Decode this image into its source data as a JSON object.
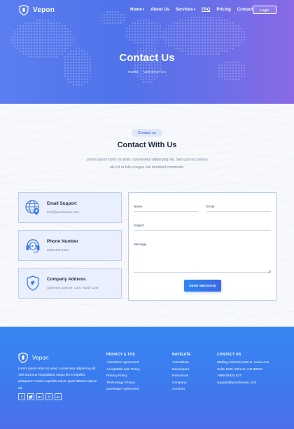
{
  "brand": {
    "name": "Vepon"
  },
  "nav": {
    "items": [
      {
        "label": "Home",
        "has_caret": true,
        "active": false
      },
      {
        "label": "About Us",
        "has_caret": false,
        "active": false
      },
      {
        "label": "Services",
        "has_caret": true,
        "active": false
      },
      {
        "label": "FAQ",
        "has_caret": false,
        "active": true
      },
      {
        "label": "Pricing",
        "has_caret": false,
        "active": false
      },
      {
        "label": "Contact",
        "has_caret": false,
        "active": false
      }
    ],
    "caret": "▾",
    "login_label": "Login"
  },
  "hero": {
    "title": "Contact Us",
    "breadcrumb": [
      "HOME",
      "CONTACT US"
    ]
  },
  "contact": {
    "pill": "Contact us",
    "title": "Contact With Us",
    "description": "Lorem ipsum dolor sit amet, consectetur adipiscing elit. Sed quis accumsan nisi Ut ut felis congue nisl hendrerit commodo.",
    "cards": [
      {
        "title": "Email Support",
        "text": "info@yourdomain.com",
        "icon": "email-globe-icon"
      },
      {
        "title": "Phone Number",
        "text": "0120-292-1424",
        "icon": "headset-24-7-icon"
      },
      {
        "title": "Company Address",
        "text": "Suite 500, Denver, USA, North Cost",
        "icon": "shield-location-icon"
      }
    ],
    "form": {
      "name_label": "Name",
      "email_label": "Email",
      "subject_label": "Subject",
      "message_label": "Message",
      "submit_label": "SEND MESSAGE"
    }
  },
  "footer": {
    "brand": "Vepon",
    "description": "Lorem ipsum dolor sit amet, consectetur adipiscing elit. Velit ducimus voluptatibus neque illo id repellat quisquam? Autem expedita earum quae laborum ipsum ad.",
    "socials": [
      "f",
      "t",
      "G+",
      "in-icon-round",
      "in"
    ],
    "social_glyphs": [
      "f",
      "🐦",
      "G+",
      "◎",
      "in"
    ],
    "columns": [
      {
        "heading": "PRIVACY & TOS",
        "items": [
          "Advertiser Agreement",
          "Acceptable Use Policy",
          "Privacy Policy",
          "Technology Privacy",
          "Developer Agreement"
        ]
      },
      {
        "heading": "NAVIGATE",
        "items": [
          "Advertisers",
          "Developers",
          "Resources",
          "Company",
          "Connect"
        ]
      },
      {
        "heading": "CONTACT US",
        "items": [
          "Mailing Address:xx00 E. Union Ave",
          "Suite 1100. Denver, CO 80237",
          "+999 90932 627",
          "support@yourdomain.com"
        ]
      }
    ]
  },
  "colors": {
    "accent": "#2f63e0",
    "hero_gradient_start": "#5b7ef0",
    "footer_blue": "#3a86f3",
    "card_bg": "#e9effc",
    "card_border": "#b9ccf2"
  }
}
